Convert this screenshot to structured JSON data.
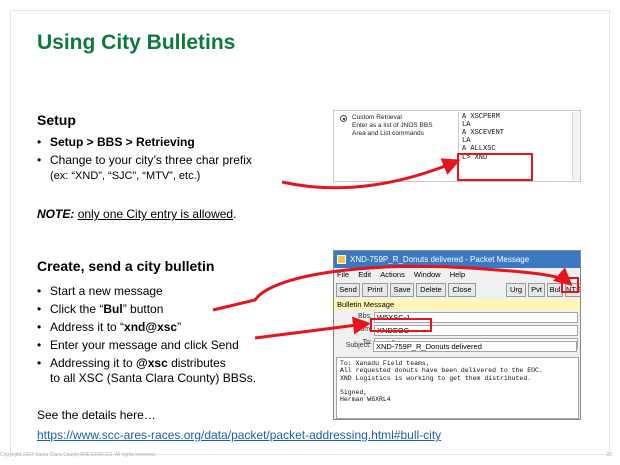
{
  "title": "Using City Bulletins",
  "setup": {
    "heading": "Setup",
    "item1": "Setup > BBS > Retrieving",
    "item2_line1": "Change to your city’s three char prefix",
    "item2_line2": "(ex:  “XND”, “SJC”, “MTV”, etc.)",
    "note_label": "NOTE:",
    "note_text": "only one City entry is allowed"
  },
  "create": {
    "heading": "Create, send a city bulletin",
    "item1": "Start a new message",
    "item2_pre": "Click the “",
    "item2_bold": "Bul",
    "item2_post": "” button",
    "item3_pre": "Address it to “",
    "item3_bold": "xnd@xsc",
    "item3_post": "”",
    "item4": "Enter your message and click Send",
    "item5_pre": "Addressing it to ",
    "item5_bold": "@xsc",
    "item5_post": " distributes",
    "item5_line2": "to all XSC (Santa Clara County) BBSs."
  },
  "details": {
    "text": "See the details here…",
    "link": "https://www.scc-ares-races.org/data/packet/packet-addressing.html#bull-city"
  },
  "footer": {
    "copyright": "Copyright 2024 Santa Clara County ARES/RACES.  All rights reserved.",
    "page": "22"
  },
  "retrieval": {
    "radio_label": "Custom Retrieval",
    "desc": "Enter as a list of JNOS BBS Area and List commands",
    "lines": [
      "A XSCPERM",
      "LA",
      "A XSCEVENT",
      "LA",
      "A ALLXSC",
      "L> XND"
    ]
  },
  "message_window": {
    "title": "XND-759P_R_Donuts delivered - Packet Message",
    "menu": [
      "File",
      "Edit",
      "Actions",
      "Window",
      "Help"
    ],
    "toolbar": [
      "Send",
      "Print",
      "Save",
      "Delete",
      "Close",
      "Urg",
      "Pvt",
      "Bul",
      "NTS"
    ],
    "banner": "Bulletin Message",
    "fields": {
      "bbs_label": "Bbs:",
      "bbs": "W5XSC-1",
      "from_label": "From:",
      "from": "XNDEOC",
      "to_label": "To:",
      "to": "xnd@xsc",
      "subject_label": "Subject:",
      "subject": "XND-759P_R_Donuts delivered"
    },
    "body": "To: Xanadu Field teams,\nAll requested donuts have been delivered to the EOC.\nXND Logistics is working to get them distributed.\n\nSigned,\nHerman W6XRL4"
  },
  "colors": {
    "title": "#0b7a3b",
    "highlight": "#e5141f",
    "link": "#1a5fb4",
    "banner": "#fff6b8",
    "titlebar": "#3a78c2"
  }
}
